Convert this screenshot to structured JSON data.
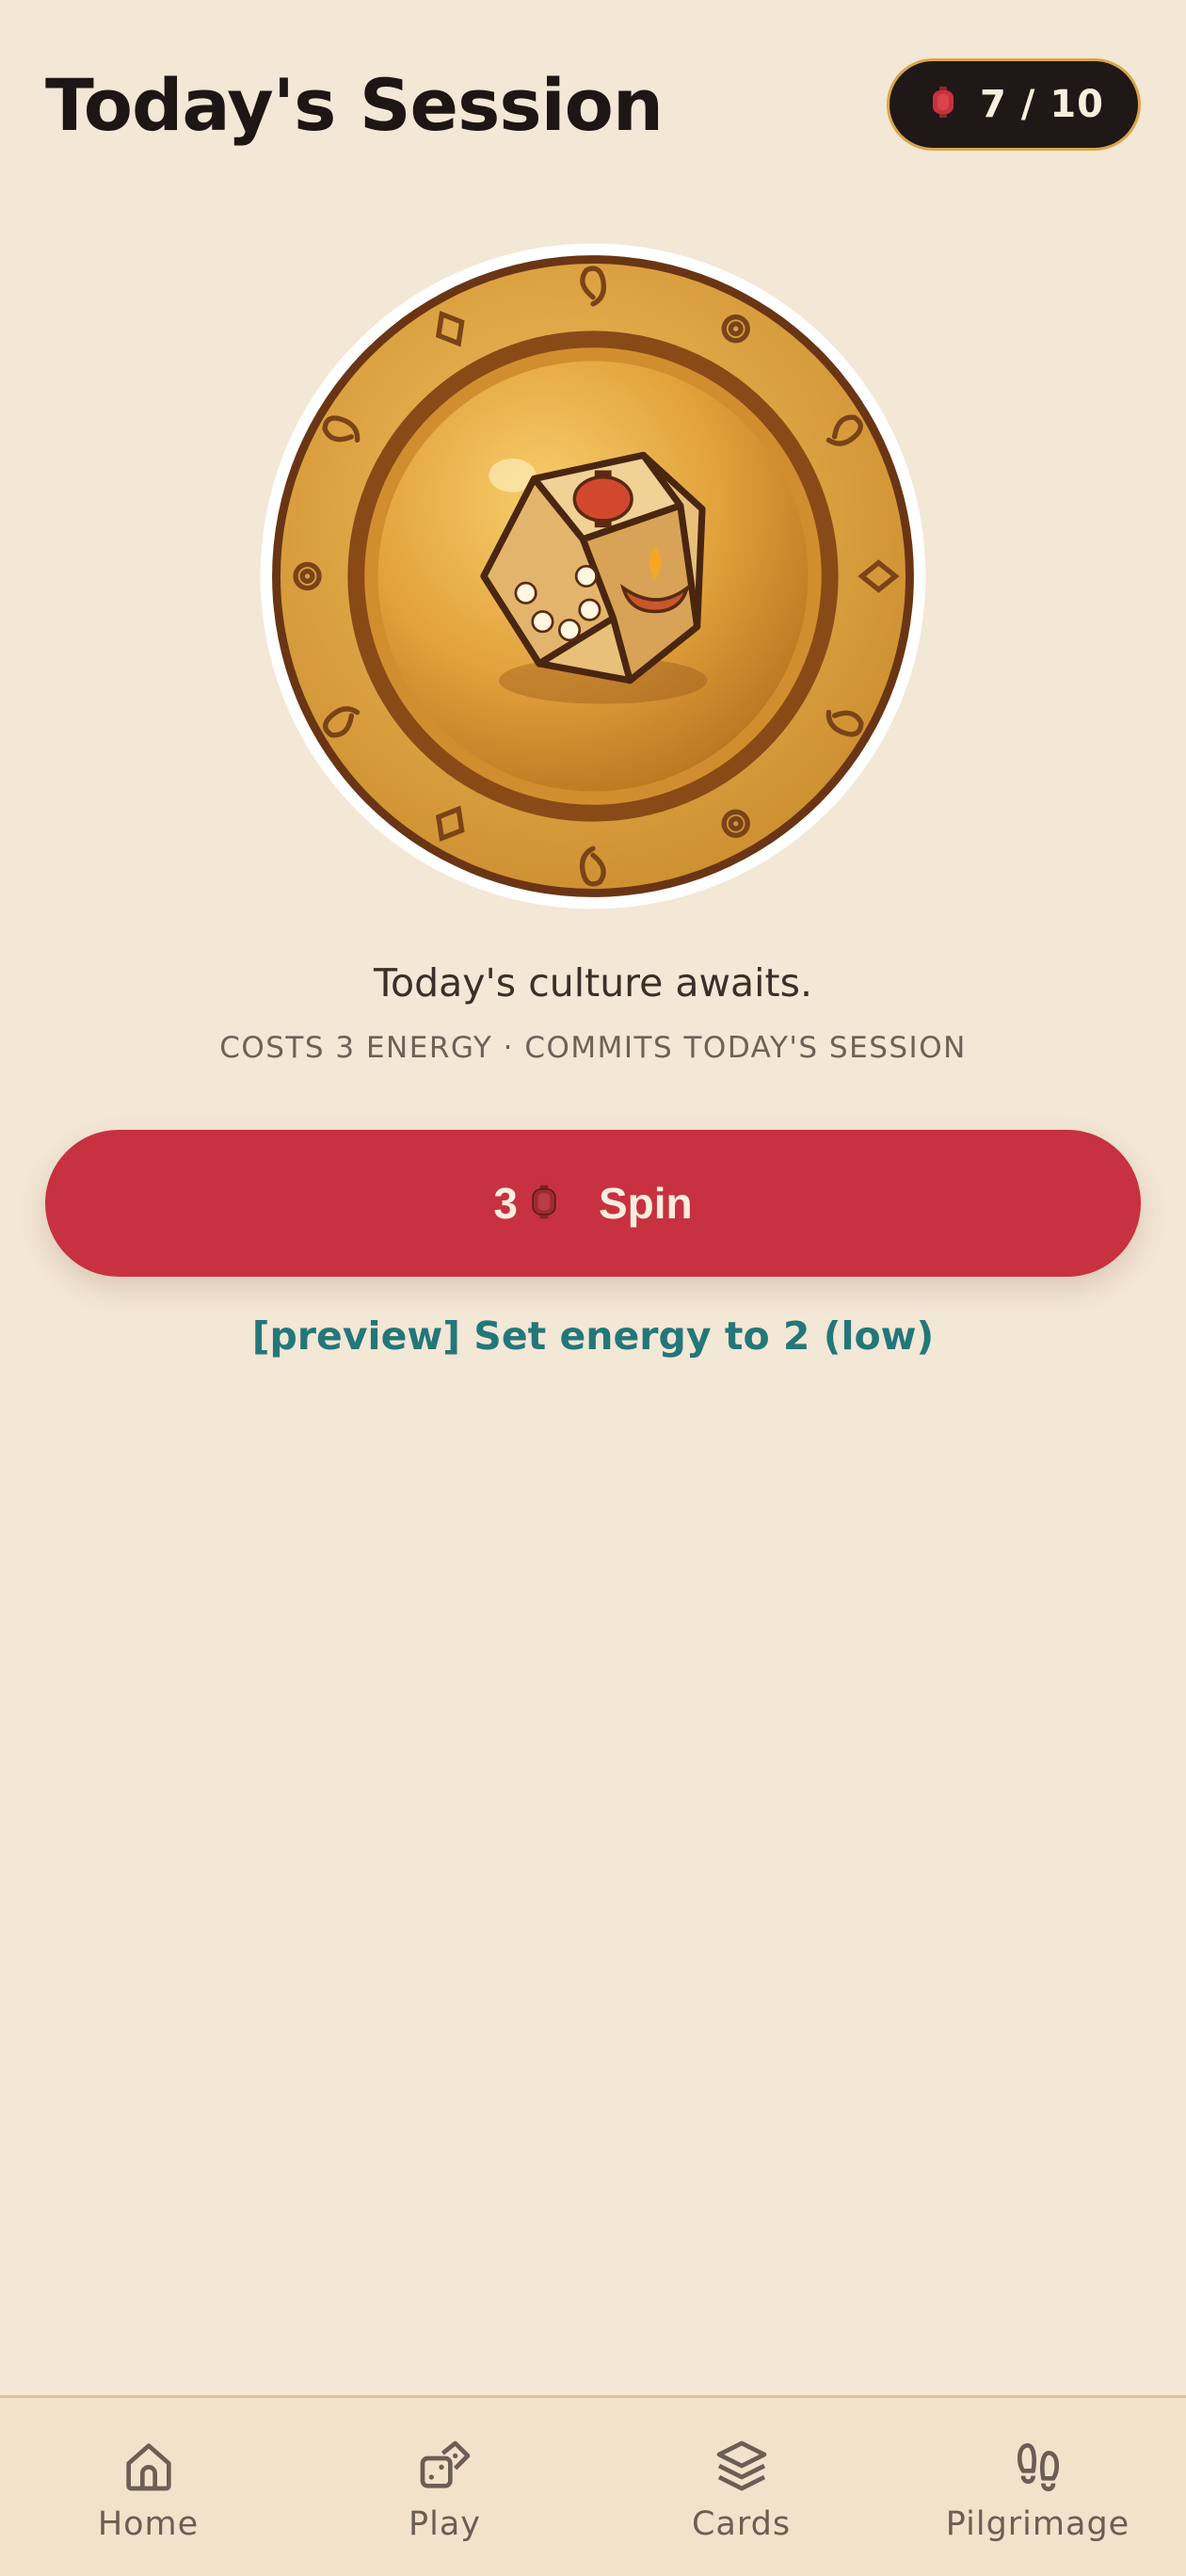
{
  "header": {
    "title": "Today's Session",
    "energy": {
      "icon": "lantern-icon",
      "display": "7 / 10",
      "current": 7,
      "max": 10
    }
  },
  "medallion": {
    "icon": "dice-medallion-icon"
  },
  "main": {
    "caption": "Today's culture awaits.",
    "subcaption": "COSTS 3 ENERGY · COMMITS TODAY'S SESSION",
    "spin_button": {
      "cost": "3",
      "cost_icon": "lantern-icon",
      "label": "Spin"
    },
    "preview_link": "[preview] Set energy to 2 (low)"
  },
  "bottom_nav": {
    "items": [
      {
        "label": "Home",
        "icon": "home-icon"
      },
      {
        "label": "Play",
        "icon": "dice-icon"
      },
      {
        "label": "Cards",
        "icon": "layers-icon"
      },
      {
        "label": "Pilgrimage",
        "icon": "footprints-icon"
      }
    ]
  },
  "colors": {
    "background": "#f3e7d5",
    "accent_red": "#c8313f",
    "link_teal": "#23777a",
    "pill_dark": "#1f1816",
    "gold": "#d9a64a"
  }
}
